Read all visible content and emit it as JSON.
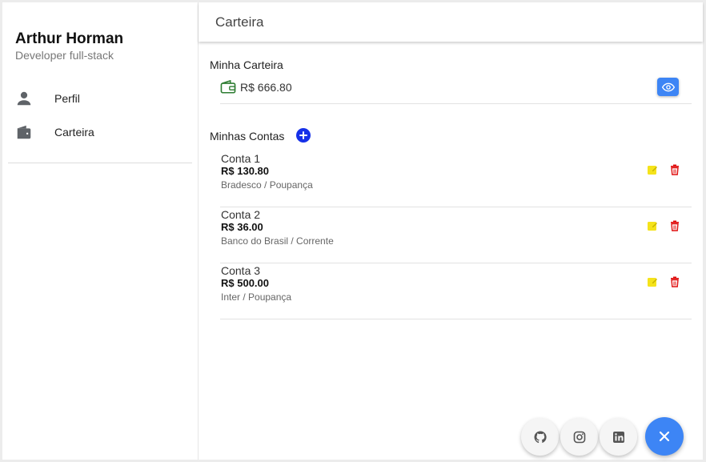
{
  "sidebar": {
    "user_name": "Arthur Horman",
    "user_role": "Developer full-stack",
    "items": [
      {
        "label": "Perfil",
        "icon": "person-icon"
      },
      {
        "label": "Carteira",
        "icon": "wallet-icon"
      }
    ]
  },
  "header": {
    "title": "Carteira"
  },
  "wallet": {
    "section_title": "Minha Carteira",
    "balance": "R$ 666.80",
    "icon": "wallet-outline-icon",
    "accent": "#2e7d32"
  },
  "accounts": {
    "section_title": "Minhas Contas",
    "items": [
      {
        "name": "Conta 1",
        "value": "R$ 130.80",
        "bank": "Bradesco / Poupança"
      },
      {
        "name": "Conta 2",
        "value": "R$ 36.00",
        "bank": "Banco do Brasil / Corrente"
      },
      {
        "name": "Conta 3",
        "value": "R$ 500.00",
        "bank": "Inter / Poupança"
      }
    ]
  },
  "fabs": [
    "github-icon",
    "instagram-icon",
    "linkedin-icon",
    "close-icon"
  ],
  "colors": {
    "primary": "#3d85f5",
    "add_button": "#1530e8",
    "edit": "#f5e31b",
    "delete": "#e01010"
  }
}
